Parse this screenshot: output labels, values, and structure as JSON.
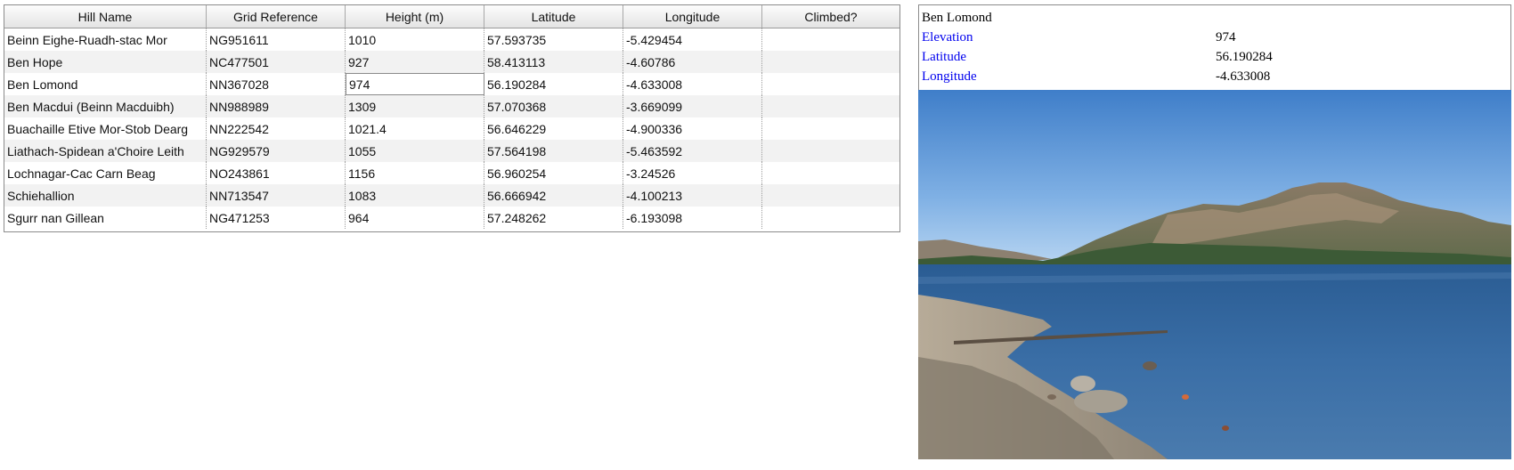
{
  "table": {
    "columns": [
      "Hill Name",
      "Grid Reference",
      "Height (m)",
      "Latitude",
      "Longitude",
      "Climbed?"
    ],
    "rows": [
      {
        "name": "Beinn Eighe-Ruadh-stac Mor",
        "grid": "NG951611",
        "height": "1010",
        "lat": "57.593735",
        "lon": "-5.429454",
        "climbed": ""
      },
      {
        "name": "Ben Hope",
        "grid": "NC477501",
        "height": "927",
        "lat": "58.413113",
        "lon": "-4.60786",
        "climbed": ""
      },
      {
        "name": "Ben Lomond",
        "grid": "NN367028",
        "height": "974",
        "lat": "56.190284",
        "lon": "-4.633008",
        "climbed": ""
      },
      {
        "name": "Ben Macdui (Beinn Macduibh)",
        "grid": "NN988989",
        "height": "1309",
        "lat": "57.070368",
        "lon": "-3.669099",
        "climbed": ""
      },
      {
        "name": "Buachaille Etive Mor-Stob Dearg",
        "grid": "NN222542",
        "height": "1021.4",
        "lat": "56.646229",
        "lon": "-4.900336",
        "climbed": ""
      },
      {
        "name": "Liathach-Spidean a'Choire Leith",
        "grid": "NG929579",
        "height": "1055",
        "lat": "57.564198",
        "lon": "-5.463592",
        "climbed": ""
      },
      {
        "name": "Lochnagar-Cac Carn Beag",
        "grid": "NO243861",
        "height": "1156",
        "lat": "56.960254",
        "lon": "-3.24526",
        "climbed": ""
      },
      {
        "name": "Schiehallion",
        "grid": "NN713547",
        "height": "1083",
        "lat": "56.666942",
        "lon": "-4.100213",
        "climbed": ""
      },
      {
        "name": "Sgurr nan Gillean",
        "grid": "NG471253",
        "height": "964",
        "lat": "57.248262",
        "lon": "-6.193098",
        "climbed": ""
      }
    ]
  },
  "detail": {
    "title": "Ben Lomond",
    "fields": [
      {
        "label": "Elevation",
        "value": "974"
      },
      {
        "label": "Latitude",
        "value": "56.190284"
      },
      {
        "label": "Longitude",
        "value": "-4.633008"
      }
    ],
    "link_color": "#0000ee"
  },
  "photo": {
    "subject": "loch-and-mountain-landscape"
  }
}
